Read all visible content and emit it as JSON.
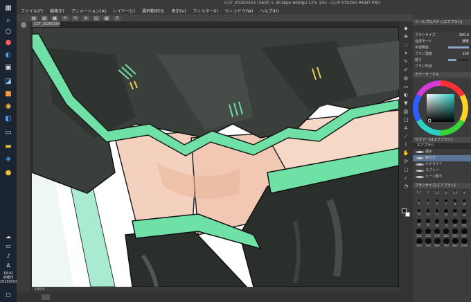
{
  "window": {
    "title": "CCF_20200304 (3600 × 4518px 600dpi 12% 1%) - CLIP STUDIO PAINT PRO"
  },
  "menu": [
    "ファイル(F)",
    "編集(E)",
    "アニメーション(A)",
    "レイヤー(L)",
    "選択範囲(S)",
    "表示(V)",
    "フィルター(I)",
    "ウィンドウ(W)",
    "ヘルプ(H)"
  ],
  "document_tab": "CCF_20200304",
  "taskbar": {
    "time": "18:41",
    "weekday": "水曜日",
    "date": "2020/03/04"
  },
  "status": {
    "zoom": "100.0"
  },
  "panels": {
    "tool_property": {
      "header": "ツールプロパティ[エアブラシ]",
      "brush_size_label": "ブラシサイズ",
      "brush_size_value": "300.0",
      "blend_mode_label": "合成モード",
      "blend_mode_value": "通常",
      "opacity_label": "不透明度",
      "brush_density_label": "ブラシ濃度",
      "brush_density_value": "100",
      "soft_label": "硬さ",
      "color_label": "ブラシ形状"
    },
    "color_wheel": {
      "header": "カラーサークル",
      "main_color": "#1a1a1a",
      "sub_color": "#ffffff"
    },
    "sub_tool": {
      "header": "サブツール[エアブラシ]",
      "group": "エアブラシ",
      "items": [
        "強め",
        "柔らか",
        "ハイライト",
        "スプレー",
        "トーン削り"
      ],
      "selected_index": 1
    },
    "brush_size": {
      "header": "ブラシサイズ[エアブラシ]",
      "sizes": [
        "0.7",
        "1",
        "1.5",
        "2",
        "2.5",
        "3",
        "4",
        "5",
        "6",
        "7",
        "8",
        "10",
        "12",
        "15",
        "17",
        "20",
        "25",
        "30",
        "40",
        "50",
        "60",
        "70",
        "80",
        "100",
        "120",
        "150",
        "170",
        "200",
        "250",
        "300",
        "400",
        "500",
        "600",
        "700",
        "800",
        "1000"
      ]
    }
  },
  "colors": {
    "accent_green": "#6fe0a6",
    "skirt_dark": "#3a3f3b",
    "stocking": "#2a2f2c",
    "skin": "#f4d1bf"
  }
}
